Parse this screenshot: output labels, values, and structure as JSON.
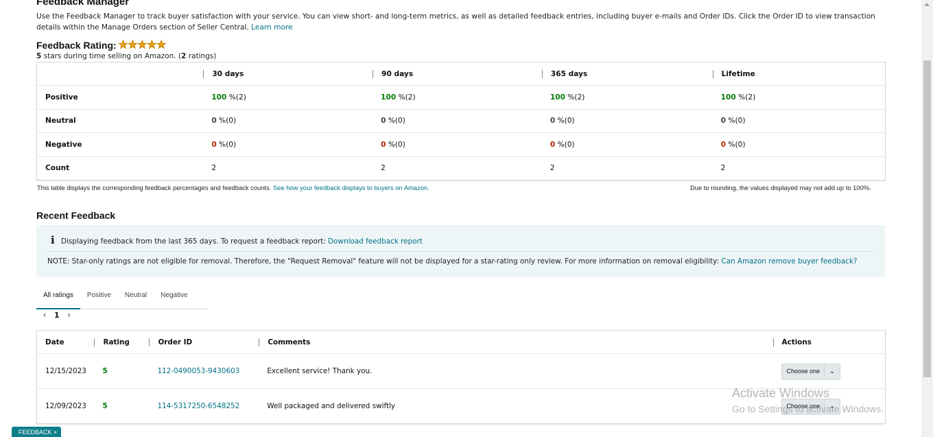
{
  "page": {
    "title": "Feedback Manager",
    "intro_text": "Use the Feedback Manager to track buyer satisfaction with your service. You can view short- and long-term metrics, as well as detailed feedback entries, including buyer e-mails and Order IDs. Click the Order ID to view transaction details within the Manage Orders section of Seller Central.",
    "learn_more": "Learn more"
  },
  "rating": {
    "heading": "Feedback Rating:",
    "stars": 5,
    "stars_value": "5",
    "stars_text": " stars during time selling on Amazon. (",
    "ratings_count": "2",
    "ratings_suffix": " ratings)"
  },
  "metrics": {
    "columns": [
      "30 days",
      "90 days",
      "365 days",
      "Lifetime"
    ],
    "rows": [
      {
        "label": "Positive",
        "cells": [
          {
            "pct": "100",
            "rest": " %(2)"
          },
          {
            "pct": "100",
            "rest": " %(2)"
          },
          {
            "pct": "100",
            "rest": " %(2)"
          },
          {
            "pct": "100",
            "rest": " %(2)"
          }
        ]
      },
      {
        "label": "Neutral",
        "cells": [
          {
            "pct": "0",
            "rest": " %(0)"
          },
          {
            "pct": "0",
            "rest": " %(0)"
          },
          {
            "pct": "0",
            "rest": " %(0)"
          },
          {
            "pct": "0",
            "rest": " %(0)"
          }
        ]
      },
      {
        "label": "Negative",
        "cells": [
          {
            "pct": "0",
            "rest": " %(0)"
          },
          {
            "pct": "0",
            "rest": " %(0)"
          },
          {
            "pct": "0",
            "rest": " %(0)"
          },
          {
            "pct": "0",
            "rest": " %(0)"
          }
        ]
      },
      {
        "label": "Count",
        "cells": [
          {
            "pct": "",
            "rest": "2"
          },
          {
            "pct": "",
            "rest": "2"
          },
          {
            "pct": "",
            "rest": "2"
          },
          {
            "pct": "",
            "rest": "2"
          }
        ]
      }
    ],
    "note_left": "This table displays the corresponding feedback percentages and feedback counts.",
    "note_link": "See how your feedback displays to buyers on Amazon.",
    "note_right": "Due to rounding, the values displayed may not add up to 100%."
  },
  "recent": {
    "title": "Recent Feedback",
    "info_icon": "info-icon",
    "info_text": "Displaying feedback from the last 365 days. To request a feedback report:",
    "info_link": "Download feedback report",
    "note_text": "NOTE: Star-only ratings are not eligible for removal. Therefore, the \"Request Removal\" feature will not be displayed for a star-rating only review. For more information on removal eligibility:",
    "note_link": "Can Amazon remove buyer feedback?",
    "tabs": [
      "All ratings",
      "Positive",
      "Neutral",
      "Negative"
    ],
    "page_number": "1",
    "columns": {
      "date": "Date",
      "rating": "Rating",
      "order": "Order ID",
      "comments": "Comments",
      "actions": "Actions"
    },
    "rows": [
      {
        "date": "12/15/2023",
        "rating": "5",
        "order": "112-0490053-9430603",
        "comment": "Excellent service! Thank you.",
        "action": "Choose one"
      },
      {
        "date": "12/09/2023",
        "rating": "5",
        "order": "114-5317250-6548252",
        "comment": "Well packaged and delivered swiftly",
        "action": "Choose one"
      }
    ]
  },
  "watermark": {
    "line1": "Activate Windows",
    "line2": "Go to Settings to activate Windows."
  },
  "feedback_tab": "FEEDBACK",
  "colors": {
    "link": "#007185",
    "positive": "#067d06",
    "negative": "#b12704",
    "star": "#f0a81e",
    "info_bg": "#eef5f7",
    "feedback_tab": "#0e7f8a"
  }
}
